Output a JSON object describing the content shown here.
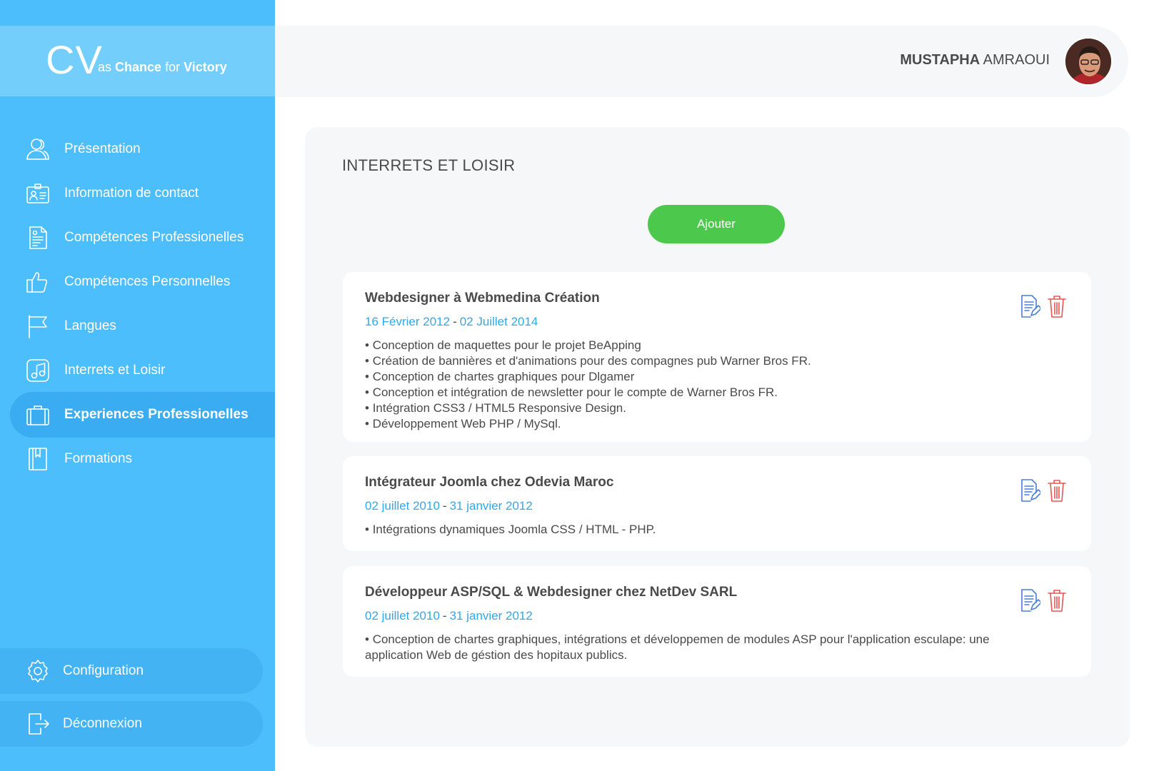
{
  "logo": {
    "big": "CV",
    "as": "as",
    "chance": "Chance",
    "for": "for",
    "victory": "Victory"
  },
  "sidebar": {
    "items": [
      {
        "label": "Présentation",
        "icon": "users-icon"
      },
      {
        "label": "Information de contact",
        "icon": "id-card-icon"
      },
      {
        "label": "Compétences Professionelles",
        "icon": "document-icon"
      },
      {
        "label": "Compétences Personnelles",
        "icon": "thumbs-up-icon"
      },
      {
        "label": "Langues",
        "icon": "flag-icon"
      },
      {
        "label": "Interrets et Loisir",
        "icon": "music-icon"
      },
      {
        "label": "Experiences Professionelles",
        "icon": "briefcase-icon",
        "active": true
      },
      {
        "label": "Formations",
        "icon": "book-icon"
      }
    ],
    "configuration": "Configuration",
    "logout": "Déconnexion"
  },
  "header": {
    "first_name": "MUSTAPHA",
    "last_name": "AMRAOUI"
  },
  "main": {
    "title": "INTERRETS ET LOISIR",
    "add_label": "Ajouter",
    "cards": [
      {
        "title": "Webdesigner à Webmedina Création",
        "start": "16 Février 2012",
        "sep": "-",
        "end": "02 Juillet 2014",
        "bullets": [
          "Conception de maquettes pour le projet BeApping",
          "Création de bannières et d'animations pour des compagnes pub Warner Bros FR.",
          "Conception de chartes graphiques pour Dlgamer",
          "Conception et intégration de newsletter pour le compte de Warner Bros FR.",
          "Intégration CSS3 / HTML5 Responsive Design.",
          "Développement Web PHP / MySql."
        ]
      },
      {
        "title": "Intégrateur Joomla chez Odevia Maroc",
        "start": "02 juillet 2010",
        "sep": "-",
        "end": "31 janvier 2012",
        "bullets": [
          "Intégrations dynamiques Joomla CSS / HTML - PHP."
        ]
      },
      {
        "title": "Développeur ASP/SQL & Webdesigner chez NetDev SARL",
        "start": "02 juillet 2010",
        "sep": "-",
        "end": "31 janvier 2012",
        "bullets": [
          "Conception de chartes graphiques, intégrations et développemen de modules ASP pour l'application esculape: une application Web de géstion des hopitaux publics."
        ]
      }
    ]
  },
  "colors": {
    "sidebar": "#4dbefc",
    "active": "#39acf2",
    "accent": "#2fa9ee",
    "add": "#4cc94c",
    "edit": "#4a7fd6",
    "delete": "#e85555"
  }
}
